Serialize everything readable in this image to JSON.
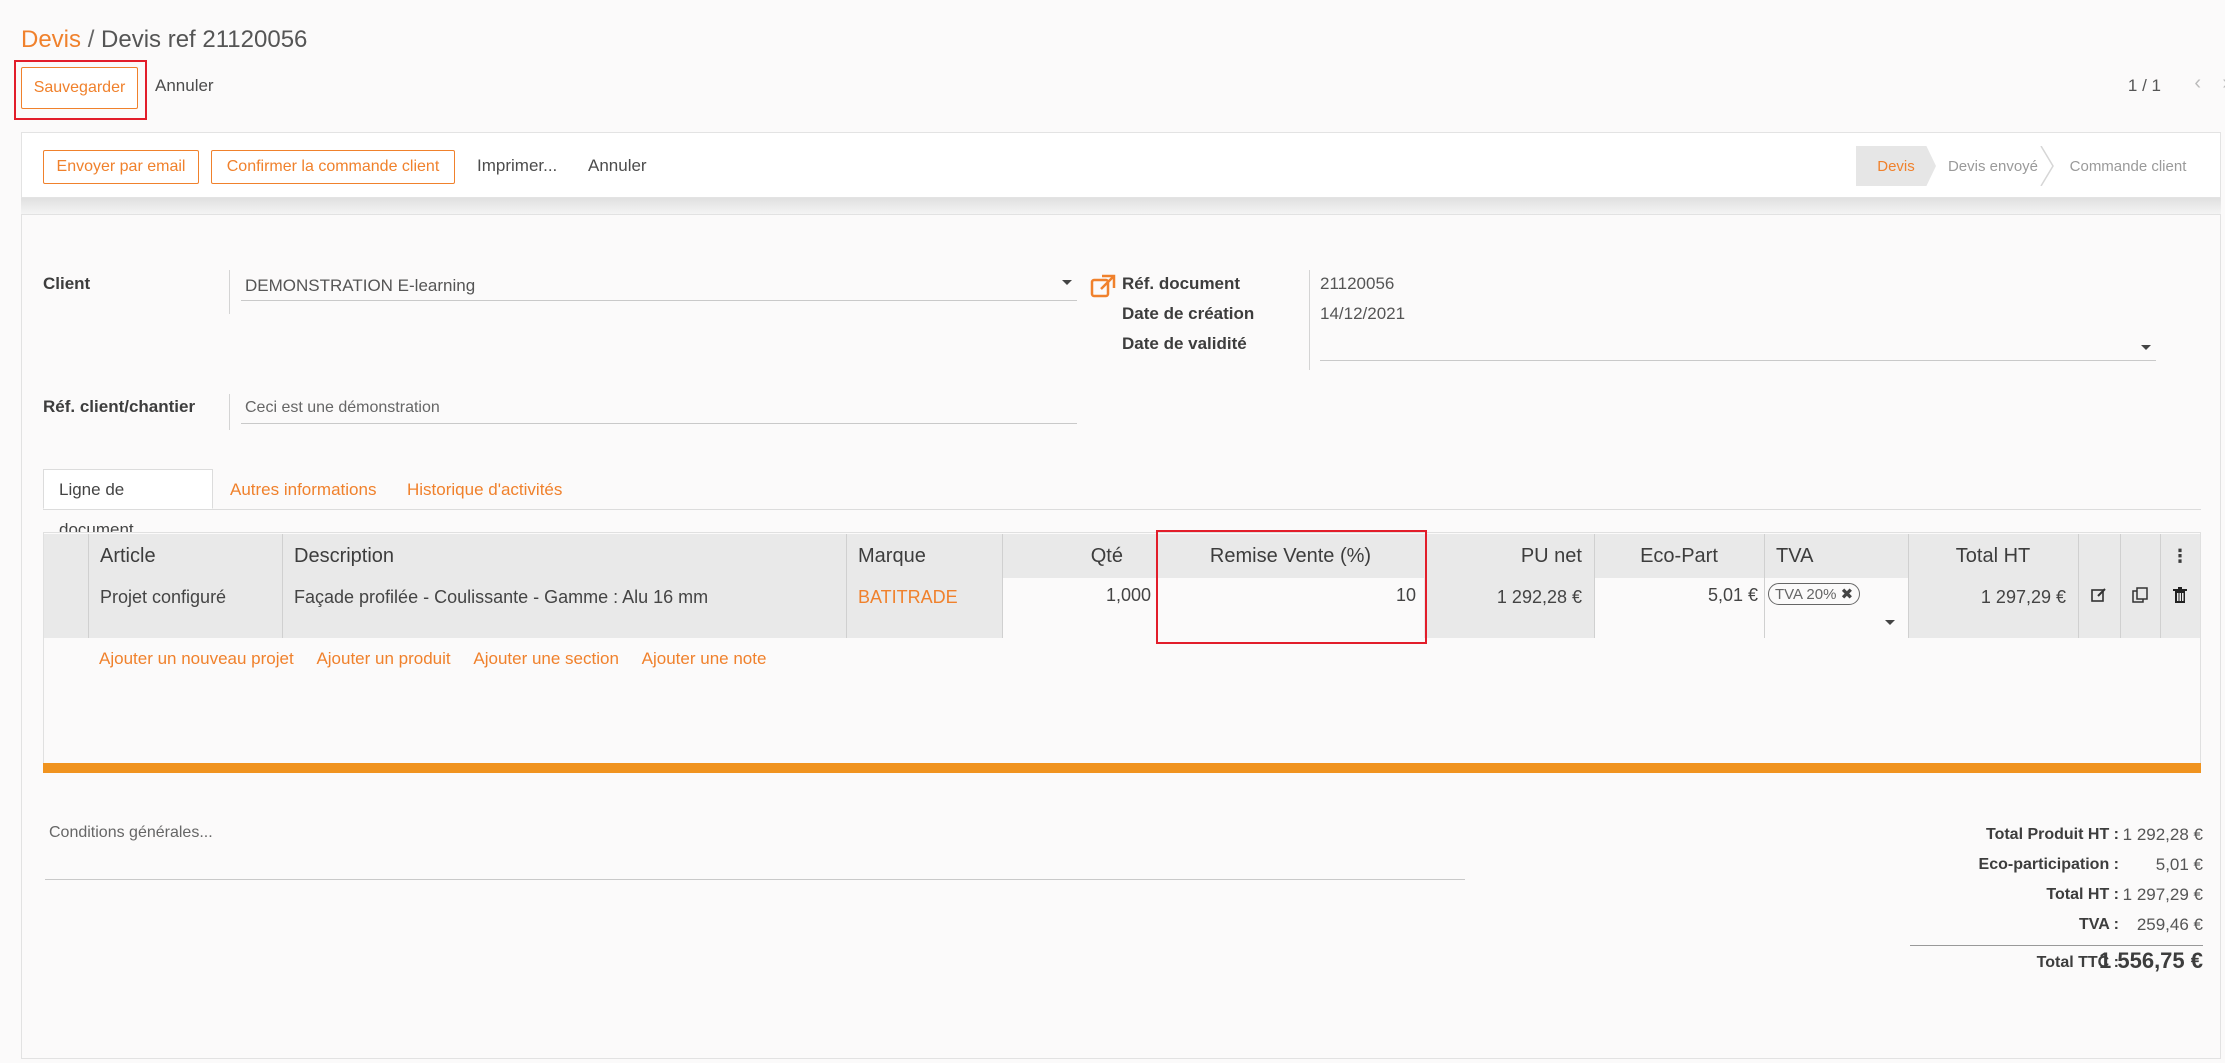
{
  "breadcrumb": {
    "root": "Devis",
    "separator": "/",
    "current": "Devis ref 21120056"
  },
  "control": {
    "save": "Sauvegarder",
    "cancel": "Annuler",
    "pager": "1 / 1"
  },
  "actions": {
    "send_email": "Envoyer par email",
    "confirm_order": "Confirmer la commande client",
    "print": "Imprimer...",
    "cancel": "Annuler"
  },
  "status": {
    "stages": [
      "Devis",
      "Devis envoyé",
      "Commande client"
    ],
    "active": "Devis"
  },
  "form": {
    "client_label": "Client",
    "client_value": "DEMONSTRATION E-learning",
    "ref_client_label": "Réf. client/chantier",
    "ref_client_value": "Ceci est une démonstration",
    "ref_doc_label": "Réf. document",
    "ref_doc_value": "21120056",
    "date_creation_label": "Date de création",
    "date_creation_value": "14/12/2021",
    "date_validite_label": "Date de validité",
    "date_validite_value": ""
  },
  "tabs": [
    "Ligne de document",
    "Autres informations",
    "Historique d'activités"
  ],
  "table": {
    "headers": {
      "article": "Article",
      "description": "Description",
      "marque": "Marque",
      "qte": "Qté",
      "remise": "Remise Vente (%)",
      "pu_net": "PU net",
      "eco_part": "Eco-Part",
      "tva": "TVA",
      "total_ht": "Total HT"
    },
    "rows": [
      {
        "article": "Projet configuré",
        "description": "Façade profilée - Coulissante - Gamme : Alu 16 mm",
        "marque": "BATITRADE",
        "qte": "1,000",
        "remise": "10",
        "pu_net": "1 292,28 €",
        "eco_part": "5,01 €",
        "tva": "TVA 20%",
        "total_ht": "1 297,29 €"
      }
    ],
    "add_links": [
      "Ajouter un nouveau projet",
      "Ajouter un produit",
      "Ajouter une section",
      "Ajouter une note"
    ]
  },
  "conditions_placeholder": "Conditions générales...",
  "totals": {
    "total_produit_ht_label": "Total Produit HT :",
    "total_produit_ht": "1 292,28 €",
    "eco_label": "Eco-participation :",
    "eco": "5,01 €",
    "total_ht_label": "Total HT :",
    "total_ht": "1 297,29 €",
    "tva_label": "TVA :",
    "tva": "259,46 €",
    "ttc_label": "Total TTC :",
    "ttc": "1 556,75 €"
  },
  "colors": {
    "accent": "#f0812c",
    "highlight": "#e21d2a",
    "progress": "#f0931f"
  }
}
